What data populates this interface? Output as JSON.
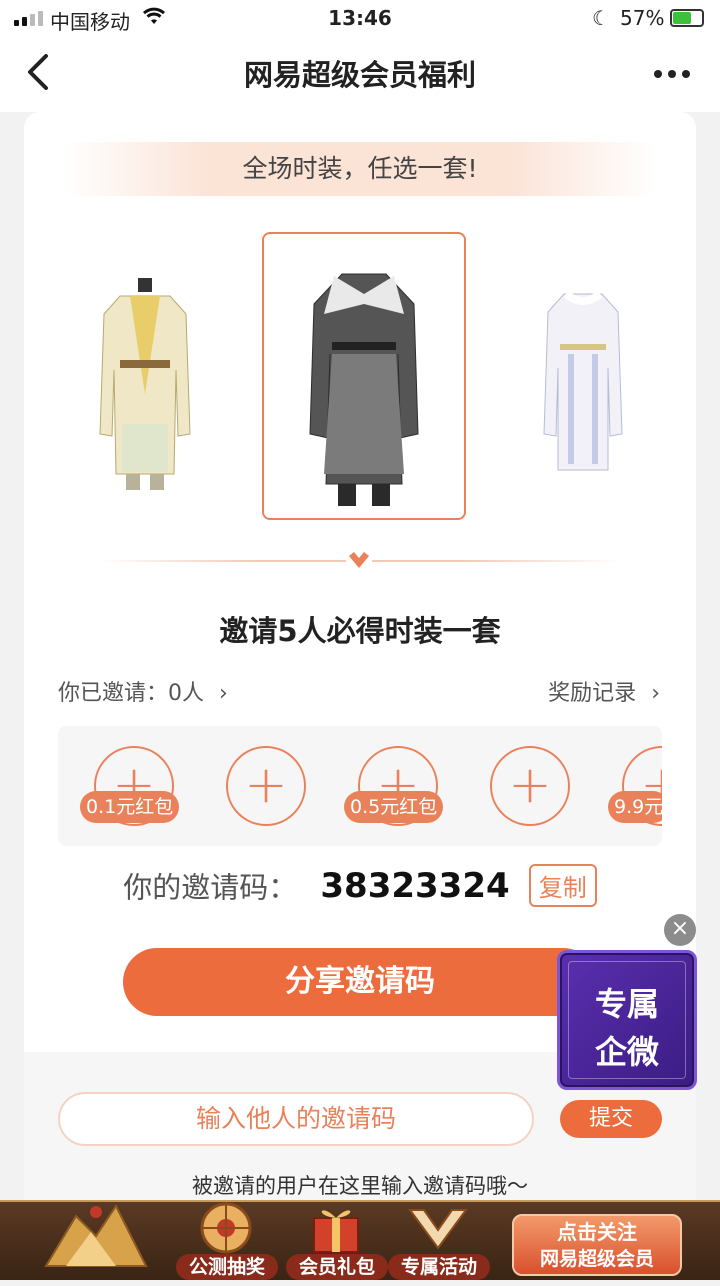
{
  "status_bar": {
    "carrier": "中国移动",
    "time": "13:46",
    "battery": "57%"
  },
  "nav": {
    "back_icon": "chevron-left-icon",
    "title": "网易超级会员福利",
    "more_icon": "more-dots-icon"
  },
  "banner": {
    "text": "全场时装，任选一套!"
  },
  "outfits": [
    {
      "name": "gold-robe",
      "colors": [
        "#e9d98a",
        "#f4efe0"
      ]
    },
    {
      "name": "dark-robe",
      "colors": [
        "#4a4a4a",
        "#8c8c8c"
      ],
      "selected": true
    },
    {
      "name": "white-robe",
      "colors": [
        "#eeeef5",
        "#c5cbe8"
      ]
    }
  ],
  "invite": {
    "headline": "邀请5人必得时装一套",
    "invited_label": "你已邀请：0人",
    "records_label": "奖励记录",
    "slots": [
      {
        "tag": "0.1元红包"
      },
      {
        "tag": ""
      },
      {
        "tag": "0.5元红包"
      },
      {
        "tag": ""
      },
      {
        "tag": "9.9元"
      }
    ],
    "code_label": "你的邀请码：",
    "code_value": "38323324",
    "copy_label": "复制",
    "share_label": "分享邀请码"
  },
  "redeem": {
    "input_placeholder": "输入他人的邀请码",
    "submit_label": "提交",
    "hint": "被邀请的用户在这里输入邀请码哦～"
  },
  "floating": {
    "close_icon": "close-icon",
    "line1": "专属",
    "line2": "企微"
  },
  "footer": {
    "items": [
      {
        "label": "公测抽奖"
      },
      {
        "label": "会员礼包"
      },
      {
        "label": "专属活动"
      }
    ],
    "follow_line1": "点击关注",
    "follow_line2": "网易超级会员"
  },
  "colors": {
    "accent": "#ec6c3d",
    "accent_light": "#e9825a"
  }
}
